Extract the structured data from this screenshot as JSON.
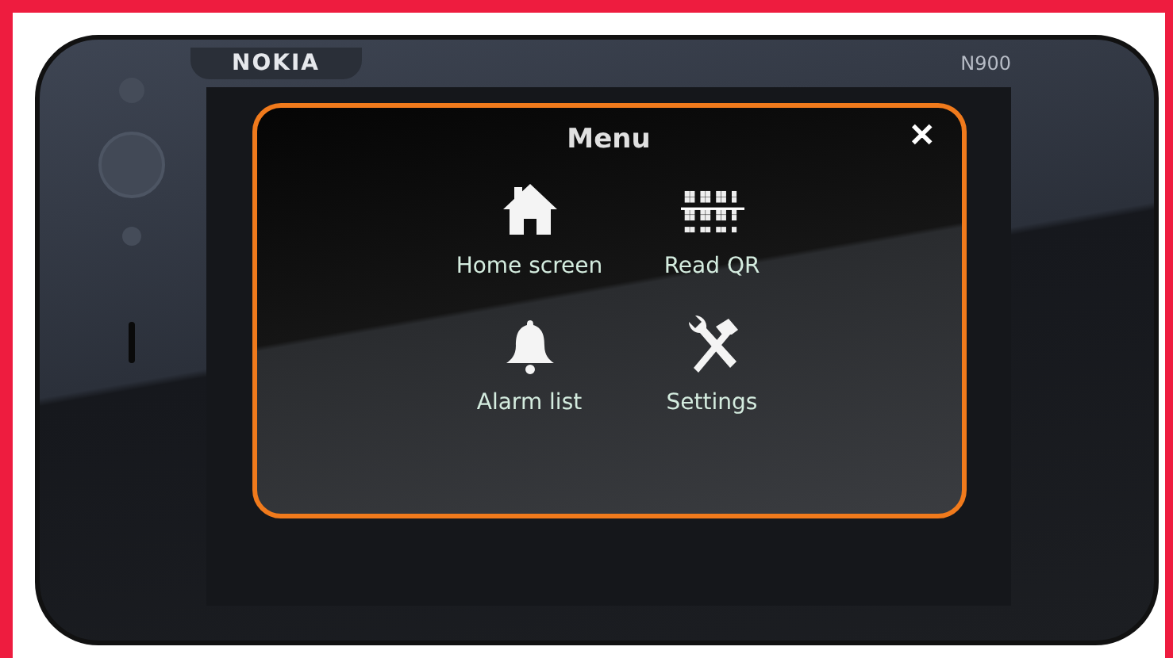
{
  "device": {
    "brand": "NOKIA",
    "model": "N900"
  },
  "menu": {
    "title": "Menu",
    "close": "✕",
    "items": [
      {
        "kind": "home",
        "label": "Home screen"
      },
      {
        "kind": "qr",
        "label": "Read QR"
      },
      {
        "kind": "bell",
        "label": "Alarm list"
      },
      {
        "kind": "tools",
        "label": "Settings"
      }
    ]
  }
}
